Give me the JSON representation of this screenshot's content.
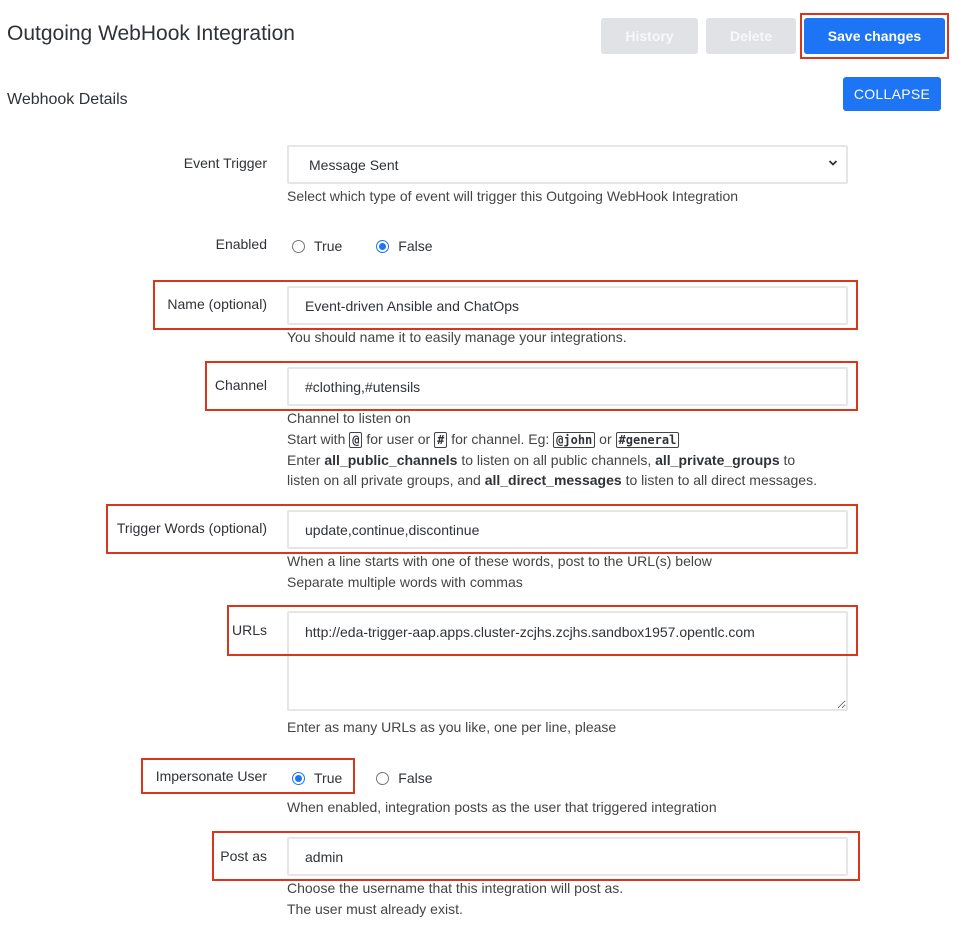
{
  "header": {
    "title": "Outgoing WebHook Integration",
    "buttons": {
      "history": "History",
      "delete": "Delete",
      "save": "Save changes"
    }
  },
  "section": {
    "title": "Webhook Details",
    "collapse_label": "COLLAPSE"
  },
  "form": {
    "event_trigger": {
      "label": "Event Trigger",
      "value": "Message Sent",
      "hint": "Select which type of event will trigger this Outgoing WebHook Integration"
    },
    "enabled": {
      "label": "Enabled",
      "options": [
        "True",
        "False"
      ],
      "selected": "False"
    },
    "name": {
      "label": "Name (optional)",
      "value": "Event-driven Ansible and ChatOps",
      "hint": "You should name it to easily manage your integrations."
    },
    "channel": {
      "label": "Channel",
      "value": "#clothing,#utensils",
      "hint_line1": "Channel to listen on",
      "hint_line2": {
        "start": "Start with",
        "at_symbol": "@",
        "for_user": "for user or",
        "hash_symbol": "#",
        "for_channel": "for channel. Eg:",
        "example_user": "@john",
        "or": "or",
        "example_channel": "#general"
      },
      "hint_line3": {
        "enter": "Enter",
        "public": "all_public_channels",
        "public_text": "to listen on all public channels,",
        "private": "all_private_groups",
        "to": "to"
      },
      "hint_line4": {
        "private_text": "listen on all private groups, and",
        "direct": "all_direct_messages",
        "direct_text": "to listen to all direct messages."
      }
    },
    "trigger_words": {
      "label": "Trigger Words (optional)",
      "value": "update,continue,discontinue",
      "hint_line1": "When a line starts with one of these words, post to the URL(s) below",
      "hint_line2": "Separate multiple words with commas"
    },
    "urls": {
      "label": "URLs",
      "value": "http://eda-trigger-aap.apps.cluster-zcjhs.zcjhs.sandbox1957.opentlc.com",
      "hint": "Enter as many URLs as you like, one per line, please"
    },
    "impersonate_user": {
      "label": "Impersonate User",
      "options": [
        "True",
        "False"
      ],
      "selected": "True",
      "hint": "When enabled, integration posts as the user that triggered integration"
    },
    "post_as": {
      "label": "Post as",
      "value": "admin",
      "hint_line1": "Choose the username that this integration will post as.",
      "hint_line2": "The user must already exist."
    }
  },
  "colors": {
    "primary": "#1d74f5",
    "disabled_button": "#e0e2e5",
    "highlight_box": "#d9361e",
    "text": "#2f3337"
  }
}
